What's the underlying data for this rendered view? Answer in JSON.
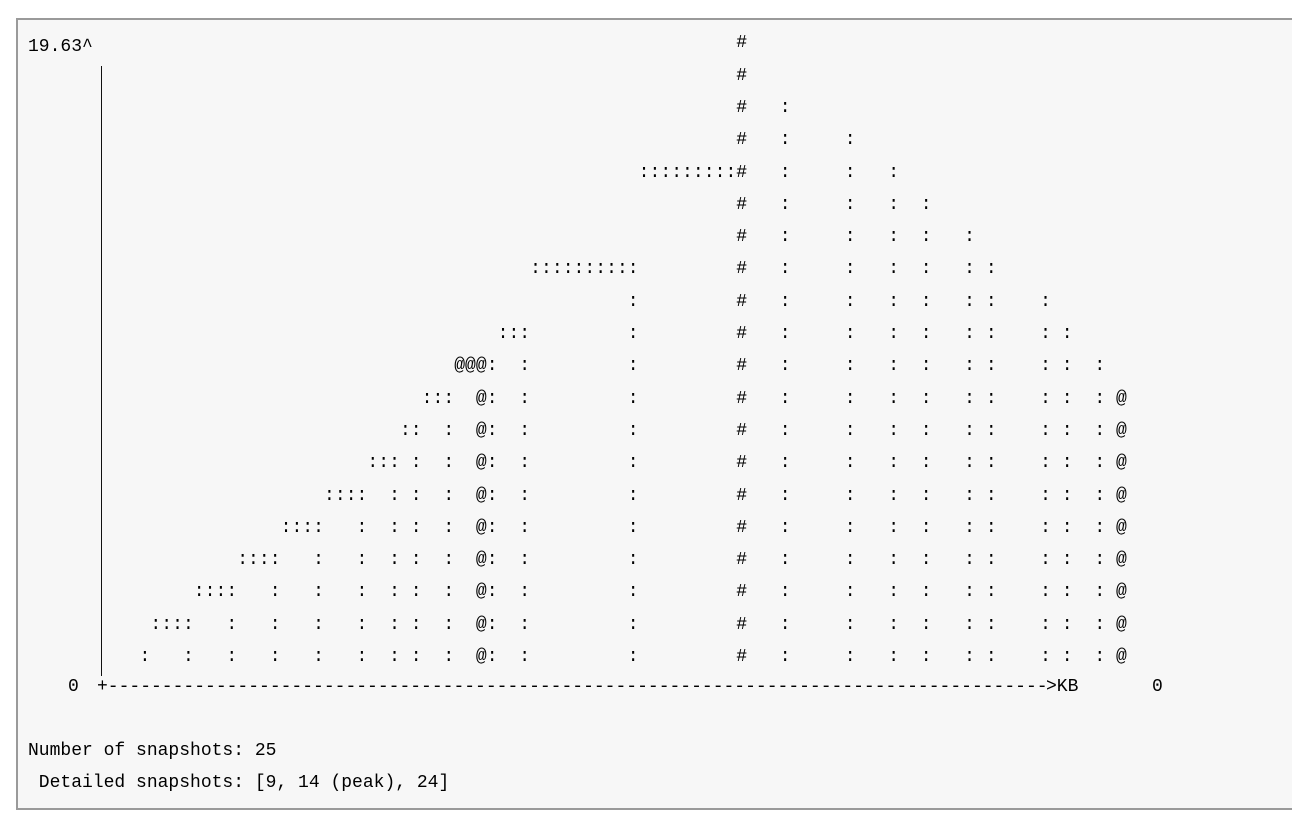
{
  "chart_data": {
    "type": "area",
    "title": "",
    "ylabel": "",
    "xlabel": "",
    "y_top_label": "19.63^",
    "y_zero_label": "0",
    "x_unit_label": ">KB",
    "x_zero_label": "0",
    "ylim": [
      0,
      19.63
    ],
    "snapshots": [
      {
        "index": 0,
        "rows": 1,
        "marker": ":"
      },
      {
        "index": 1,
        "rows": 2,
        "marker": ":"
      },
      {
        "index": 2,
        "rows": 3,
        "marker": ":"
      },
      {
        "index": 3,
        "rows": 4,
        "marker": ":"
      },
      {
        "index": 4,
        "rows": 5,
        "marker": ":"
      },
      {
        "index": 5,
        "rows": 6,
        "marker": ":"
      },
      {
        "index": 6,
        "rows": 7,
        "marker": ":"
      },
      {
        "index": 7,
        "rows": 8,
        "marker": ":"
      },
      {
        "index": 8,
        "rows": 9,
        "marker": ":"
      },
      {
        "index": 9,
        "rows": 10,
        "marker": "@"
      },
      {
        "index": 10,
        "rows": 10,
        "marker": ":"
      },
      {
        "index": 11,
        "rows": 11,
        "marker": ":"
      },
      {
        "index": 12,
        "rows": 13,
        "marker": ":"
      },
      {
        "index": 13,
        "rows": 16,
        "marker": ":"
      },
      {
        "index": 14,
        "rows": 20,
        "marker": "#"
      },
      {
        "index": 15,
        "rows": 18,
        "marker": ":"
      },
      {
        "index": 16,
        "rows": 17,
        "marker": ":"
      },
      {
        "index": 17,
        "rows": 16,
        "marker": ":"
      },
      {
        "index": 18,
        "rows": 15,
        "marker": ":"
      },
      {
        "index": 19,
        "rows": 14,
        "marker": ":"
      },
      {
        "index": 20,
        "rows": 13,
        "marker": ":"
      },
      {
        "index": 21,
        "rows": 12,
        "marker": ":"
      },
      {
        "index": 22,
        "rows": 11,
        "marker": ":"
      },
      {
        "index": 23,
        "rows": 10,
        "marker": ":"
      },
      {
        "index": 24,
        "rows": 9,
        "marker": "@"
      }
    ]
  },
  "summary": {
    "snapshot_count_line": "Number of snapshots: 25",
    "detailed_line": " Detailed snapshots: [9, 14 (peak), 24]"
  }
}
